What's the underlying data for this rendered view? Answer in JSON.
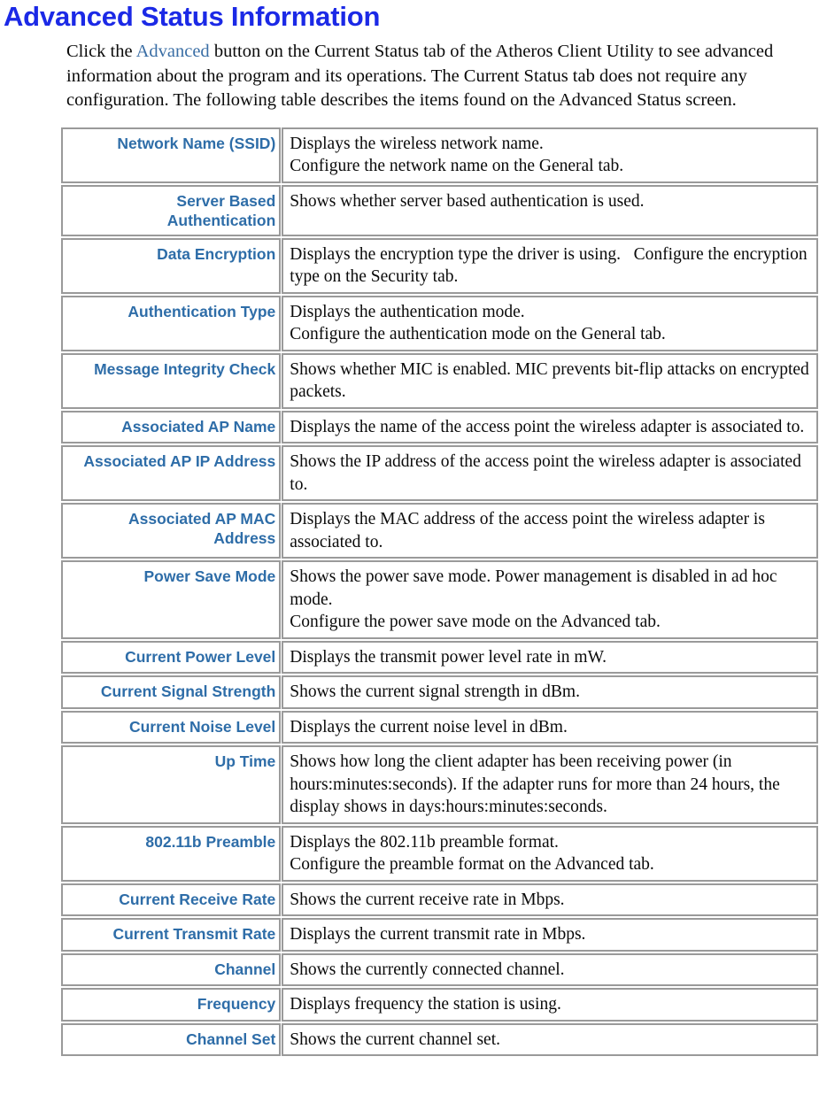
{
  "document": {
    "title": "Advanced Status Information",
    "title_color": "#1b29e6",
    "label_color": "#2e6da8",
    "border_color": "#9a9a9a",
    "intro": {
      "before_link": "Click the ",
      "link_text": "Advanced",
      "after_link": " button on the Current Status tab of the Atheros Client Utility to see advanced information about the program and its operations. The Current Status tab does not require any configuration.  The following table describes the items found on the Advanced Status screen."
    }
  },
  "table": {
    "rows": [
      {
        "label": "Network Name (SSID)",
        "description": "Displays the wireless network name.\nConfigure the network name on the General tab."
      },
      {
        "label": "Server Based Authentication",
        "description": "Shows whether server based authentication is used."
      },
      {
        "label": "Data Encryption",
        "description": "Displays the encryption type the driver is using.   Configure the encryption type on the Security tab."
      },
      {
        "label": "Authentication Type",
        "description": "Displays the authentication mode.\nConfigure the authentication mode on the General tab."
      },
      {
        "label": "Message Integrity Check",
        "description": "Shows whether MIC is enabled. MIC prevents bit-flip attacks on encrypted packets."
      },
      {
        "label": "Associated AP Name",
        "description": "Displays the name of the access point the wireless adapter is associated to."
      },
      {
        "label": "Associated AP IP Address",
        "description": "Shows the IP address of the access point the wireless adapter is associated to."
      },
      {
        "label": "Associated AP MAC Address",
        "description": "Displays the MAC address of the access point the wireless adapter is associated to."
      },
      {
        "label": "Power Save Mode",
        "description": "Shows the power save mode. Power management is disabled in ad hoc mode.\nConfigure the power save mode on the Advanced tab."
      },
      {
        "label": "Current Power Level",
        "description": "Displays the transmit power level rate in mW."
      },
      {
        "label": "Current Signal Strength",
        "description": "Shows the current signal strength in dBm."
      },
      {
        "label": "Current Noise Level",
        "description": "Displays the current noise level in dBm."
      },
      {
        "label": "Up Time",
        "description": "Shows how long the client adapter has been receiving power (in hours:minutes:seconds). If the adapter runs for more than 24 hours, the display shows in days:hours:minutes:seconds."
      },
      {
        "label": "802.11b Preamble",
        "description": "Displays the 802.11b preamble format.\nConfigure the preamble format on the Advanced tab."
      },
      {
        "label": "Current Receive Rate",
        "description": "Shows the current receive rate in Mbps."
      },
      {
        "label": "Current Transmit Rate",
        "description": "Displays the current transmit rate in Mbps."
      },
      {
        "label": "Channel",
        "description": "Shows the currently connected channel."
      },
      {
        "label": "Frequency",
        "description": "Displays frequency the station is using."
      },
      {
        "label": "Channel Set",
        "description": "Shows the current channel set."
      }
    ]
  }
}
